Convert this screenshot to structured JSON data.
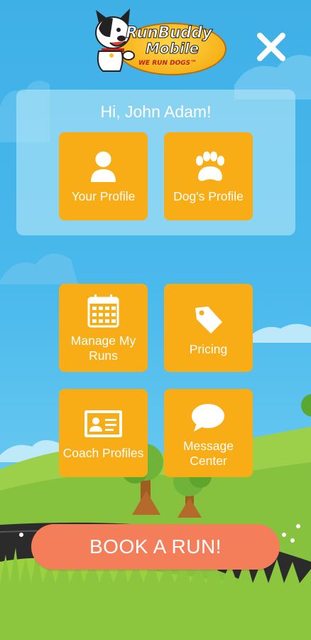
{
  "app": {
    "name": "RunBuddy Mobile",
    "logo_line1": "RunBuddy",
    "logo_line2": "Mobile",
    "logo_tagline": "WE RUN DOGS™"
  },
  "header": {
    "close_icon": "close-icon"
  },
  "greeting": "Hi, John Adam!",
  "profile_tiles": [
    {
      "label": "Your Profile",
      "icon": "person-icon"
    },
    {
      "label": "Dog's Profile",
      "icon": "paw-icon"
    }
  ],
  "menu_tiles": [
    {
      "label": "Manage My Runs",
      "icon": "calendar-icon"
    },
    {
      "label": "Pricing",
      "icon": "price-tag-icon"
    },
    {
      "label": "Coach Profiles",
      "icon": "id-card-icon"
    },
    {
      "label": "Message Center",
      "icon": "speech-bubble-icon"
    }
  ],
  "cta": {
    "label": "BOOK A RUN!"
  },
  "colors": {
    "sky": "#4ab9ec",
    "tile": "#f8ac16",
    "cta": "#f47d5a",
    "grass": "#8cc63e",
    "panel": "#b4e6f8"
  }
}
